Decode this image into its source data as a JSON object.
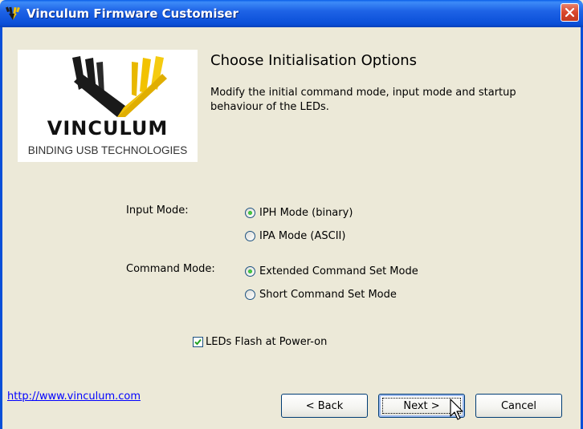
{
  "window": {
    "title": "Vinculum Firmware Customiser",
    "app_icon": "vinculum-app-icon",
    "close_icon": "close-icon"
  },
  "logo": {
    "wordmark": "VINCULUM",
    "tagline": "BINDING USB TECHNOLOGIES",
    "colors": {
      "dark": "#1A1A1A",
      "gold": "#F2C200"
    }
  },
  "page": {
    "heading": "Choose Initialisation Options",
    "description": "Modify the initial command mode, input mode and startup behaviour of the LEDs."
  },
  "input_mode": {
    "label": "Input Mode:",
    "options": [
      {
        "label": "IPH Mode (binary)",
        "selected": true
      },
      {
        "label": "IPA Mode (ASCII)",
        "selected": false
      }
    ]
  },
  "command_mode": {
    "label": "Command Mode:",
    "options": [
      {
        "label": "Extended Command Set Mode",
        "selected": true
      },
      {
        "label": "Short Command Set Mode",
        "selected": false
      }
    ]
  },
  "leds_flash": {
    "label": "LEDs Flash at Power-on",
    "checked": true
  },
  "footer": {
    "link": "http://www.vinculum.com",
    "back_label": "< Back",
    "next_label": "Next >",
    "cancel_label": "Cancel"
  },
  "colors": {
    "titlebar": "#0A4FD8",
    "dialog_bg": "#ECE9D8",
    "radio_dot": "#21A121",
    "link": "#0000FF"
  }
}
